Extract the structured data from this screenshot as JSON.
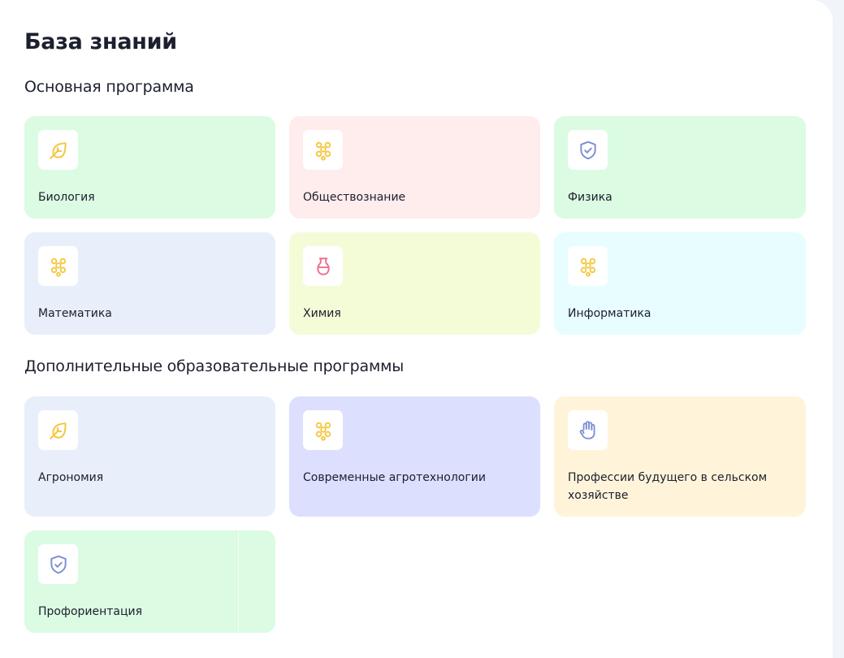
{
  "page": {
    "title": "База знаний"
  },
  "sections": [
    {
      "title": "Основная программа",
      "cards": [
        {
          "label": "Биология",
          "bg": "#dbfbe2",
          "icon": "leaf-icon"
        },
        {
          "label": "Обществознание",
          "bg": "#ffecec",
          "icon": "molecule-icon"
        },
        {
          "label": "Физика",
          "bg": "#dbfbe2",
          "icon": "shield-check-icon"
        },
        {
          "label": "Математика",
          "bg": "#e9eefb",
          "icon": "molecule-icon"
        },
        {
          "label": "Химия",
          "bg": "#f3fcd7",
          "icon": "flask-icon"
        },
        {
          "label": "Информатика",
          "bg": "#e7fdff",
          "icon": "molecule-icon"
        }
      ]
    },
    {
      "title": "Дополнительные образовательные программы",
      "cards": [
        {
          "label": "Агрономия",
          "bg": "#e9eefb",
          "icon": "leaf-icon"
        },
        {
          "label": "Современные агротехнологии",
          "bg": "#dcdffe",
          "icon": "molecule-icon"
        },
        {
          "label": "Профессии будущего в сельском хозяйстве",
          "bg": "#fff4d9",
          "icon": "hand-icon"
        },
        {
          "label": "Профориентация",
          "bg": "#dbfbe2",
          "icon": "shield-check-icon"
        }
      ]
    }
  ],
  "colors": {
    "icon_yellow": "#f5c63c",
    "icon_blue": "#7c8fd6",
    "icon_pink": "#ef6f8d"
  }
}
